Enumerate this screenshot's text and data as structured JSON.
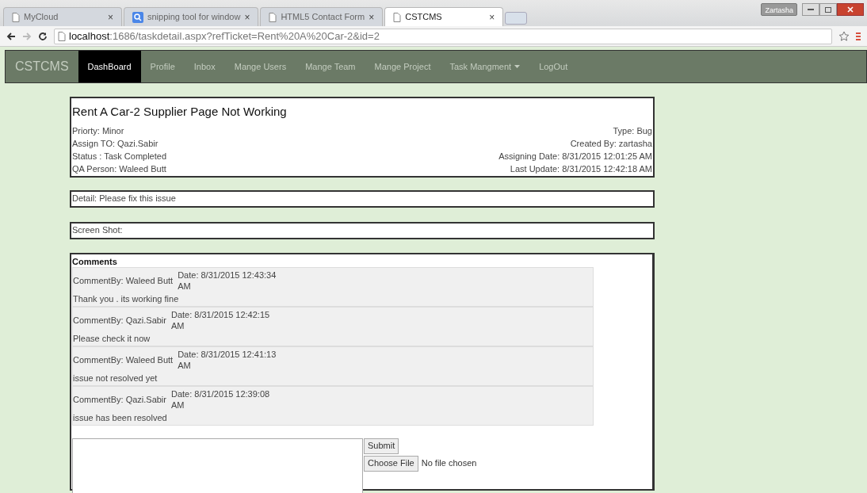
{
  "browser": {
    "tabs": [
      {
        "title": "MyCloud",
        "selected": false,
        "kind": "page"
      },
      {
        "title": "snipping tool for window",
        "selected": false,
        "kind": "search"
      },
      {
        "title": "HTML5 Contact Form",
        "selected": false,
        "kind": "page"
      },
      {
        "title": "CSTCMS",
        "selected": true,
        "kind": "page"
      }
    ],
    "close_glyph": "×",
    "user": "Zartasha",
    "url_host": "localhost",
    "url_rest": ":1686/taskdetail.aspx?refTicket=Rent%20A%20Car-2&id=2"
  },
  "navbar": {
    "brand": "CSTCMS",
    "items": [
      {
        "label": "DashBoard",
        "selected": true,
        "dropdown": false
      },
      {
        "label": "Profile",
        "selected": false,
        "dropdown": false
      },
      {
        "label": "Inbox",
        "selected": false,
        "dropdown": false
      },
      {
        "label": "Mange Users",
        "selected": false,
        "dropdown": false
      },
      {
        "label": "Mange Team",
        "selected": false,
        "dropdown": false
      },
      {
        "label": "Mange Project",
        "selected": false,
        "dropdown": false
      },
      {
        "label": "Task Mangment",
        "selected": false,
        "dropdown": true
      },
      {
        "label": "LogOut",
        "selected": false,
        "dropdown": false
      }
    ]
  },
  "task": {
    "title": "Rent A Car-2 Supplier Page Not Working",
    "left": [
      "Priorty: Minor",
      "Assign TO: Qazi.Sabir",
      "Status : Task Completed",
      "QA Person: Waleed Butt"
    ],
    "right": [
      "Type: Bug",
      "Created By: zartasha",
      "Assigning Date: 8/31/2015 12:01:25 AM",
      "Last Update: 8/31/2015 12:42:18 AM"
    ]
  },
  "detail": "Detail: Please fix this issue",
  "screenshot": "Screen Shot:",
  "comments": {
    "heading": "Comments",
    "items": [
      {
        "by": "CommentBy: Waleed Butt",
        "date": "Date: 8/31/2015 12:43:34",
        "date_suffix": "AM",
        "text": "Thank you . its working fine"
      },
      {
        "by": "CommentBy: Qazi.Sabir",
        "date": "Date: 8/31/2015 12:42:15",
        "date_suffix": "AM",
        "text": "Please check it now"
      },
      {
        "by": "CommentBy: Waleed Butt",
        "date": "Date: 8/31/2015 12:41:13",
        "date_suffix": "AM",
        "text": "issue not resolved yet"
      },
      {
        "by": "CommentBy: Qazi.Sabir",
        "date": "Date: 8/31/2015 12:39:08",
        "date_suffix": "AM",
        "text": "issue has been resolved"
      }
    ],
    "submit": "Submit",
    "choose_file": "Choose File",
    "file_status": "No file chosen"
  }
}
